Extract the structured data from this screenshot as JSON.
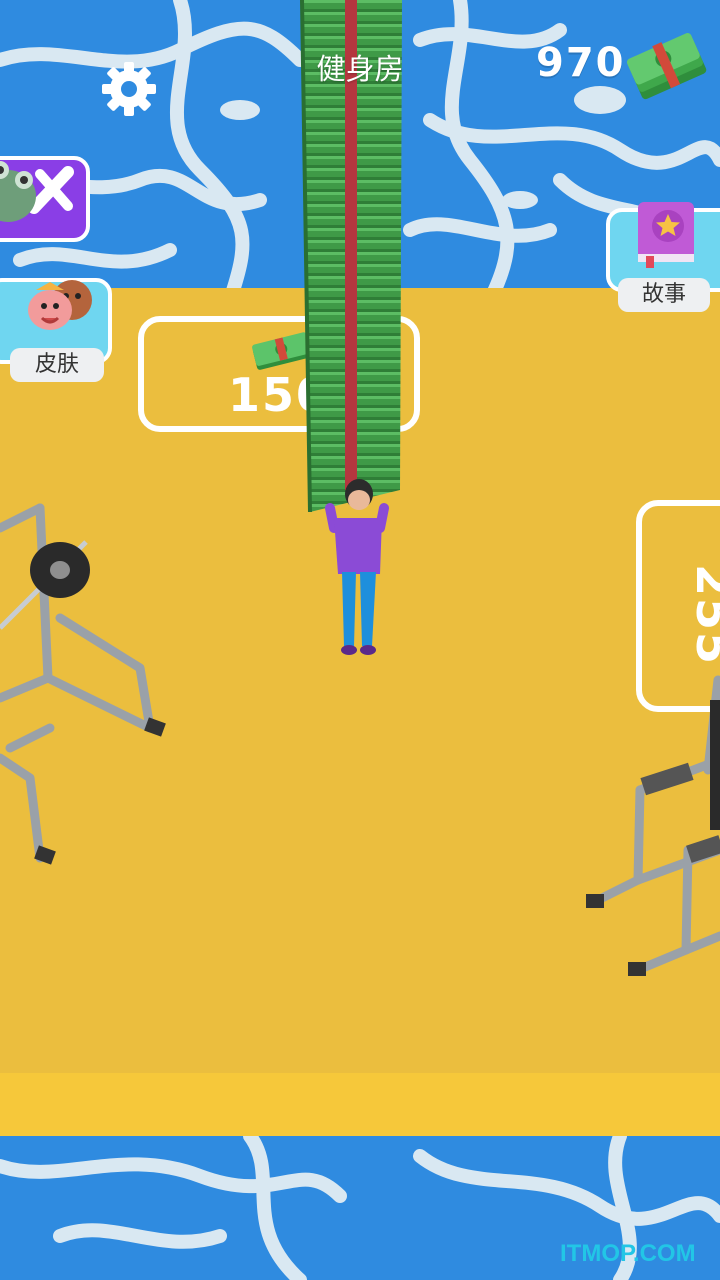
{
  "header": {
    "title": "健身房",
    "money": "970"
  },
  "buttons": {
    "skin_label": "皮肤",
    "story_label": "故事"
  },
  "zones": {
    "left_price": "150",
    "right_price": "255"
  },
  "watermark": "ITMOP.COM",
  "icons": {
    "settings": "gear-icon",
    "money": "cash-stack-icon",
    "skill": "frog-tools-icon",
    "skin": "faces-icon",
    "story": "star-book-icon"
  },
  "colors": {
    "water": "#2f8be0",
    "floor": "#ebbe3e",
    "skill_button": "#8a3ee6",
    "skin_button": "#6fd6f0",
    "money_green": "#3aa24a"
  }
}
